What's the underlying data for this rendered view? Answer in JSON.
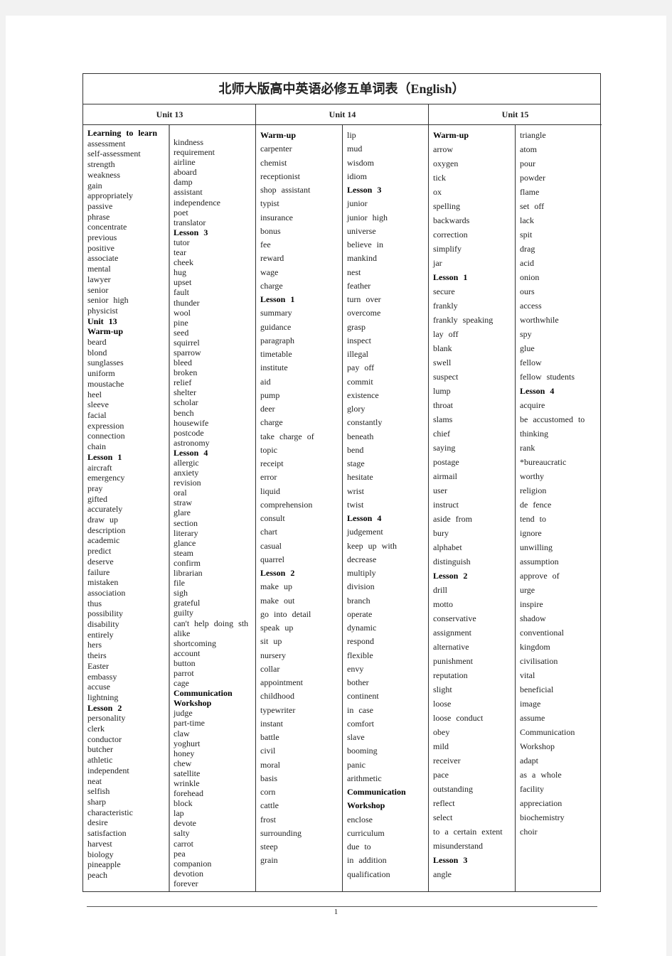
{
  "title": "北师大版高中英语必修五单词表（English）",
  "units": [
    "Unit 13",
    "Unit 14",
    "Unit 15"
  ],
  "columns": [
    [
      {
        "t": "Learning to learn",
        "b": true
      },
      {
        "t": "assessment"
      },
      {
        "t": "self-assessment"
      },
      {
        "t": "strength"
      },
      {
        "t": "weakness"
      },
      {
        "t": "gain"
      },
      {
        "t": "appropriately"
      },
      {
        "t": "passive"
      },
      {
        "t": "phrase"
      },
      {
        "t": "concentrate"
      },
      {
        "t": "previous"
      },
      {
        "t": "positive"
      },
      {
        "t": "associate"
      },
      {
        "t": "mental"
      },
      {
        "t": "lawyer"
      },
      {
        "t": "senior"
      },
      {
        "t": "senior high"
      },
      {
        "t": "physicist"
      },
      {
        "t": "Unit 13",
        "b": true
      },
      {
        "t": "Warm-up",
        "b": true
      },
      {
        "t": "beard"
      },
      {
        "t": "blond"
      },
      {
        "t": "sunglasses"
      },
      {
        "t": "uniform"
      },
      {
        "t": "moustache"
      },
      {
        "t": "heel"
      },
      {
        "t": "sleeve"
      },
      {
        "t": "facial"
      },
      {
        "t": "expression"
      },
      {
        "t": "connection"
      },
      {
        "t": "chain"
      },
      {
        "t": "Lesson 1",
        "b": true
      },
      {
        "t": "aircraft"
      },
      {
        "t": "emergency"
      },
      {
        "t": "pray"
      },
      {
        "t": "gifted"
      },
      {
        "t": "accurately"
      },
      {
        "t": "draw up"
      },
      {
        "t": "description"
      },
      {
        "t": "academic"
      },
      {
        "t": "predict"
      },
      {
        "t": "deserve"
      },
      {
        "t": "failure"
      },
      {
        "t": "mistaken"
      },
      {
        "t": "association"
      },
      {
        "t": "thus"
      },
      {
        "t": "possibility"
      },
      {
        "t": "disability"
      },
      {
        "t": "entirely"
      },
      {
        "t": "hers"
      },
      {
        "t": "theirs"
      },
      {
        "t": "Easter"
      },
      {
        "t": "embassy"
      },
      {
        "t": "accuse"
      },
      {
        "t": "lightning"
      },
      {
        "t": "Lesson 2",
        "b": true
      },
      {
        "t": "personality"
      },
      {
        "t": "clerk"
      },
      {
        "t": "conductor"
      },
      {
        "t": "butcher"
      },
      {
        "t": "athletic"
      },
      {
        "t": "independent"
      },
      {
        "t": "neat"
      },
      {
        "t": "selfish"
      },
      {
        "t": "sharp"
      },
      {
        "t": "characteristic"
      },
      {
        "t": "desire"
      },
      {
        "t": "satisfaction"
      },
      {
        "t": "harvest"
      },
      {
        "t": "biology"
      },
      {
        "t": "pineapple"
      },
      {
        "t": "peach"
      }
    ],
    [
      {
        "t": "kindness"
      },
      {
        "t": "requirement"
      },
      {
        "t": "airline"
      },
      {
        "t": "aboard"
      },
      {
        "t": "damp"
      },
      {
        "t": "assistant"
      },
      {
        "t": "independence"
      },
      {
        "t": "poet"
      },
      {
        "t": "translator"
      },
      {
        "t": "Lesson 3",
        "b": true
      },
      {
        "t": "tutor"
      },
      {
        "t": "tear"
      },
      {
        "t": "cheek"
      },
      {
        "t": "hug"
      },
      {
        "t": "upset"
      },
      {
        "t": "fault"
      },
      {
        "t": "thunder"
      },
      {
        "t": "wool"
      },
      {
        "t": "pine"
      },
      {
        "t": "seed"
      },
      {
        "t": "squirrel"
      },
      {
        "t": "sparrow"
      },
      {
        "t": "bleed"
      },
      {
        "t": "broken"
      },
      {
        "t": "relief"
      },
      {
        "t": "shelter"
      },
      {
        "t": "scholar"
      },
      {
        "t": "bench"
      },
      {
        "t": "housewife"
      },
      {
        "t": "postcode"
      },
      {
        "t": "astronomy"
      },
      {
        "t": "Lesson 4",
        "b": true
      },
      {
        "t": "allergic"
      },
      {
        "t": "anxiety"
      },
      {
        "t": "revision"
      },
      {
        "t": "oral"
      },
      {
        "t": "straw"
      },
      {
        "t": "glare"
      },
      {
        "t": "section"
      },
      {
        "t": "literary"
      },
      {
        "t": "glance"
      },
      {
        "t": "steam"
      },
      {
        "t": "confirm"
      },
      {
        "t": "librarian"
      },
      {
        "t": "file"
      },
      {
        "t": "sigh"
      },
      {
        "t": "grateful"
      },
      {
        "t": "guilty"
      },
      {
        "t": "can't help doing sth"
      },
      {
        "t": "alike"
      },
      {
        "t": "shortcoming"
      },
      {
        "t": "account"
      },
      {
        "t": "button"
      },
      {
        "t": "parrot"
      },
      {
        "t": "cage"
      },
      {
        "t": "Communication",
        "b": true
      },
      {
        "t": "Workshop",
        "b": true
      },
      {
        "t": "judge"
      },
      {
        "t": "part-time"
      },
      {
        "t": "claw"
      },
      {
        "t": "yoghurt"
      },
      {
        "t": "honey"
      },
      {
        "t": "chew"
      },
      {
        "t": "satellite"
      },
      {
        "t": "wrinkle"
      },
      {
        "t": "forehead"
      },
      {
        "t": "block"
      },
      {
        "t": "lap"
      },
      {
        "t": "devote"
      },
      {
        "t": "salty"
      },
      {
        "t": "carrot"
      },
      {
        "t": "pea"
      },
      {
        "t": "companion"
      },
      {
        "t": "devotion"
      },
      {
        "t": "forever"
      }
    ],
    [
      {
        "t": "Warm-up",
        "b": true
      },
      {
        "t": "carpenter"
      },
      {
        "t": "chemist"
      },
      {
        "t": "receptionist"
      },
      {
        "t": "shop assistant"
      },
      {
        "t": "typist"
      },
      {
        "t": "insurance"
      },
      {
        "t": "bonus"
      },
      {
        "t": "fee"
      },
      {
        "t": "reward"
      },
      {
        "t": "wage"
      },
      {
        "t": "charge"
      },
      {
        "t": "Lesson 1",
        "b": true
      },
      {
        "t": "summary"
      },
      {
        "t": "guidance"
      },
      {
        "t": "paragraph"
      },
      {
        "t": "timetable"
      },
      {
        "t": "institute"
      },
      {
        "t": "aid"
      },
      {
        "t": "pump"
      },
      {
        "t": "deer"
      },
      {
        "t": "charge"
      },
      {
        "t": "take charge of"
      },
      {
        "t": "topic"
      },
      {
        "t": "receipt"
      },
      {
        "t": "error"
      },
      {
        "t": "liquid"
      },
      {
        "t": "comprehension"
      },
      {
        "t": "consult"
      },
      {
        "t": "chart"
      },
      {
        "t": "casual"
      },
      {
        "t": "quarrel"
      },
      {
        "t": "Lesson 2",
        "b": true
      },
      {
        "t": "make up"
      },
      {
        "t": "make out"
      },
      {
        "t": "go into detail"
      },
      {
        "t": "speak up"
      },
      {
        "t": "sit up"
      },
      {
        "t": "nursery"
      },
      {
        "t": "collar"
      },
      {
        "t": "appointment"
      },
      {
        "t": "childhood"
      },
      {
        "t": "typewriter"
      },
      {
        "t": "instant"
      },
      {
        "t": "battle"
      },
      {
        "t": "civil"
      },
      {
        "t": "moral"
      },
      {
        "t": "basis"
      },
      {
        "t": "corn"
      },
      {
        "t": "cattle"
      },
      {
        "t": "frost"
      },
      {
        "t": "surrounding"
      },
      {
        "t": "steep"
      },
      {
        "t": "grain"
      }
    ],
    [
      {
        "t": "lip"
      },
      {
        "t": "mud"
      },
      {
        "t": "wisdom"
      },
      {
        "t": "idiom"
      },
      {
        "t": "Lesson 3",
        "b": true
      },
      {
        "t": "junior"
      },
      {
        "t": "junior high"
      },
      {
        "t": "universe"
      },
      {
        "t": "believe in"
      },
      {
        "t": "mankind"
      },
      {
        "t": "nest"
      },
      {
        "t": "feather"
      },
      {
        "t": "turn over"
      },
      {
        "t": "overcome"
      },
      {
        "t": "grasp"
      },
      {
        "t": "inspect"
      },
      {
        "t": "illegal"
      },
      {
        "t": "pay off"
      },
      {
        "t": "commit"
      },
      {
        "t": "existence"
      },
      {
        "t": "glory"
      },
      {
        "t": "constantly"
      },
      {
        "t": "beneath"
      },
      {
        "t": "bend"
      },
      {
        "t": "stage"
      },
      {
        "t": "hesitate"
      },
      {
        "t": "wrist"
      },
      {
        "t": "twist"
      },
      {
        "t": "Lesson 4",
        "b": true
      },
      {
        "t": "judgement"
      },
      {
        "t": "keep up with"
      },
      {
        "t": "decrease"
      },
      {
        "t": "multiply"
      },
      {
        "t": "division"
      },
      {
        "t": "branch"
      },
      {
        "t": "operate"
      },
      {
        "t": "dynamic"
      },
      {
        "t": "respond"
      },
      {
        "t": "flexible"
      },
      {
        "t": "envy"
      },
      {
        "t": "bother"
      },
      {
        "t": "continent"
      },
      {
        "t": "in case"
      },
      {
        "t": "comfort"
      },
      {
        "t": "slave"
      },
      {
        "t": "booming"
      },
      {
        "t": "panic"
      },
      {
        "t": "arithmetic"
      },
      {
        "t": "Communication",
        "b": true
      },
      {
        "t": "Workshop",
        "b": true
      },
      {
        "t": "enclose"
      },
      {
        "t": "curriculum"
      },
      {
        "t": "due to"
      },
      {
        "t": "in addition"
      },
      {
        "t": "qualification"
      }
    ],
    [
      {
        "t": "Warm-up",
        "b": true
      },
      {
        "t": "arrow"
      },
      {
        "t": "oxygen"
      },
      {
        "t": "tick"
      },
      {
        "t": "ox"
      },
      {
        "t": "spelling"
      },
      {
        "t": "backwards"
      },
      {
        "t": "correction"
      },
      {
        "t": "simplify"
      },
      {
        "t": "jar"
      },
      {
        "t": "Lesson 1",
        "b": true
      },
      {
        "t": "secure"
      },
      {
        "t": "frankly"
      },
      {
        "t": "frankly speaking"
      },
      {
        "t": "lay off"
      },
      {
        "t": "blank"
      },
      {
        "t": "swell"
      },
      {
        "t": "suspect"
      },
      {
        "t": "lump"
      },
      {
        "t": "throat"
      },
      {
        "t": "slams"
      },
      {
        "t": "chief"
      },
      {
        "t": "saying"
      },
      {
        "t": "postage"
      },
      {
        "t": "airmail"
      },
      {
        "t": "user"
      },
      {
        "t": "instruct"
      },
      {
        "t": "aside from"
      },
      {
        "t": "bury"
      },
      {
        "t": "alphabet"
      },
      {
        "t": "distinguish"
      },
      {
        "t": "Lesson 2",
        "b": true
      },
      {
        "t": "drill"
      },
      {
        "t": "motto"
      },
      {
        "t": "conservative"
      },
      {
        "t": "assignment"
      },
      {
        "t": "alternative"
      },
      {
        "t": "punishment"
      },
      {
        "t": "reputation"
      },
      {
        "t": "slight"
      },
      {
        "t": "loose"
      },
      {
        "t": "loose conduct"
      },
      {
        "t": "obey"
      },
      {
        "t": "mild"
      },
      {
        "t": "receiver"
      },
      {
        "t": "pace"
      },
      {
        "t": "outstanding"
      },
      {
        "t": "reflect"
      },
      {
        "t": "select"
      },
      {
        "t": "to a certain extent"
      },
      {
        "t": "misunderstand"
      },
      {
        "t": "Lesson 3",
        "b": true
      },
      {
        "t": "angle"
      }
    ],
    [
      {
        "t": "triangle"
      },
      {
        "t": "atom"
      },
      {
        "t": "pour"
      },
      {
        "t": "powder"
      },
      {
        "t": "flame"
      },
      {
        "t": "set off"
      },
      {
        "t": "lack"
      },
      {
        "t": "spit"
      },
      {
        "t": "drag"
      },
      {
        "t": "acid"
      },
      {
        "t": "onion"
      },
      {
        "t": "ours"
      },
      {
        "t": "access"
      },
      {
        "t": "worthwhile"
      },
      {
        "t": "spy"
      },
      {
        "t": "glue"
      },
      {
        "t": "fellow"
      },
      {
        "t": "fellow students"
      },
      {
        "t": "Lesson 4",
        "b": true
      },
      {
        "t": "acquire"
      },
      {
        "t": "be accustomed to"
      },
      {
        "t": "thinking"
      },
      {
        "t": "rank"
      },
      {
        "t": "*bureaucratic"
      },
      {
        "t": "worthy"
      },
      {
        "t": "religion"
      },
      {
        "t": "de fence"
      },
      {
        "t": "tend to"
      },
      {
        "t": "ignore"
      },
      {
        "t": "unwilling"
      },
      {
        "t": "assumption"
      },
      {
        "t": "approve of"
      },
      {
        "t": "urge"
      },
      {
        "t": "inspire"
      },
      {
        "t": "shadow"
      },
      {
        "t": "conventional"
      },
      {
        "t": "kingdom"
      },
      {
        "t": "civilisation"
      },
      {
        "t": "vital"
      },
      {
        "t": "beneficial"
      },
      {
        "t": "image"
      },
      {
        "t": "assume"
      },
      {
        "t": "Communication"
      },
      {
        "t": "Workshop"
      },
      {
        "t": "adapt"
      },
      {
        "t": "as a whole"
      },
      {
        "t": "facility"
      },
      {
        "t": "appreciation"
      },
      {
        "t": "biochemistry"
      },
      {
        "t": "choir"
      }
    ]
  ],
  "page_number": "1"
}
